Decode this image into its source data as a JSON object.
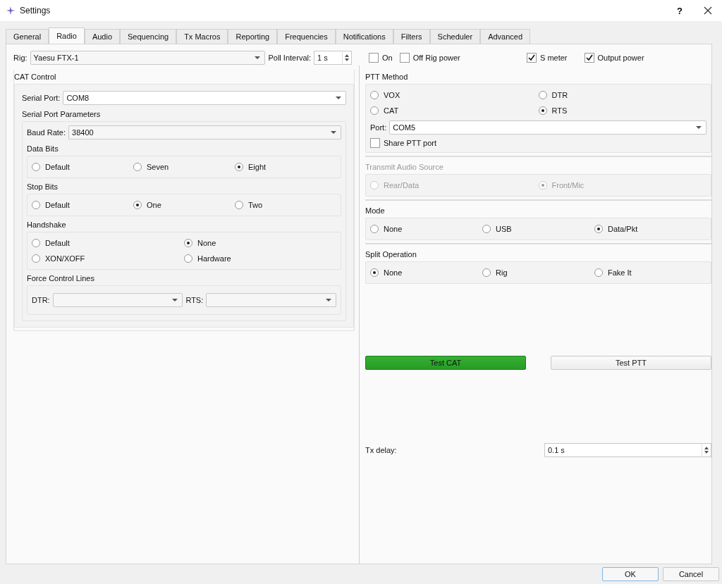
{
  "window": {
    "title": "Settings",
    "help": "?"
  },
  "tabs": [
    {
      "label": "General",
      "selected": false
    },
    {
      "label": "Radio",
      "selected": true
    },
    {
      "label": "Audio",
      "selected": false
    },
    {
      "label": "Sequencing",
      "selected": false
    },
    {
      "label": "Tx Macros",
      "selected": false
    },
    {
      "label": "Reporting",
      "selected": false
    },
    {
      "label": "Frequencies",
      "selected": false
    },
    {
      "label": "Notifications",
      "selected": false
    },
    {
      "label": "Filters",
      "selected": false
    },
    {
      "label": "Scheduler",
      "selected": false
    },
    {
      "label": "Advanced",
      "selected": false
    }
  ],
  "rig": {
    "label": "Rig:",
    "value": "Yaesu FTX-1"
  },
  "poll_interval": {
    "label": "Poll Interval:",
    "value": "1 s"
  },
  "rig_power": [
    {
      "label": "On",
      "checked": false
    },
    {
      "label": "Off Rig power",
      "checked": false
    }
  ],
  "meters": [
    {
      "label": "S meter",
      "checked": true
    },
    {
      "label": "Output power",
      "checked": true
    }
  ],
  "cat_control": {
    "title": "CAT Control",
    "serial_port": {
      "label": "Serial Port:",
      "value": "COM8"
    },
    "params_title": "Serial Port Parameters",
    "baud_rate": {
      "label": "Baud Rate:",
      "value": "38400"
    },
    "groups": [
      {
        "title": "Data Bits",
        "rows": [
          [
            {
              "label": "Default",
              "selected": false
            },
            {
              "label": "Seven",
              "selected": false
            },
            {
              "label": "Eight",
              "selected": true
            }
          ]
        ]
      },
      {
        "title": "Stop Bits",
        "rows": [
          [
            {
              "label": "Default",
              "selected": false
            },
            {
              "label": "One",
              "selected": true
            },
            {
              "label": "Two",
              "selected": false
            }
          ]
        ]
      },
      {
        "title": "Handshake",
        "rows": [
          [
            {
              "label": "Default",
              "selected": false
            },
            {
              "label": "None",
              "selected": true
            }
          ],
          [
            {
              "label": "XON/XOFF",
              "selected": false
            },
            {
              "label": "Hardware",
              "selected": false
            }
          ]
        ]
      }
    ],
    "force_lines": {
      "title": "Force Control Lines",
      "dtr_label": "DTR:",
      "rts_label": "RTS:"
    }
  },
  "ptt_method": {
    "title": "PTT Method",
    "rows": [
      [
        {
          "label": "VOX",
          "selected": false
        },
        {
          "label": "DTR",
          "selected": false
        }
      ],
      [
        {
          "label": "CAT",
          "selected": false
        },
        {
          "label": "RTS",
          "selected": true
        }
      ]
    ],
    "port": {
      "label": "Port:",
      "value": "COM5"
    },
    "share": {
      "label": "Share PTT port",
      "checked": false
    }
  },
  "right_groups": [
    {
      "title": "Transmit Audio Source",
      "disabled": true,
      "rows": [
        [
          {
            "label": "Rear/Data",
            "selected": false
          },
          {
            "label": "Front/Mic",
            "selected": true
          }
        ]
      ]
    },
    {
      "title": "Mode",
      "disabled": false,
      "rows": [
        [
          {
            "label": "None",
            "selected": false
          },
          {
            "label": "USB",
            "selected": false
          },
          {
            "label": "Data/Pkt",
            "selected": true
          }
        ]
      ]
    },
    {
      "title": "Split Operation",
      "disabled": false,
      "rows": [
        [
          {
            "label": "None",
            "selected": true
          },
          {
            "label": "Rig",
            "selected": false
          },
          {
            "label": "Fake It",
            "selected": false
          }
        ]
      ]
    }
  ],
  "test_buttons": [
    {
      "label": "Test CAT",
      "highlighted": true
    },
    {
      "label": "Test PTT",
      "highlighted": false
    }
  ],
  "tx_delay": {
    "label": "Tx delay:",
    "value": "0.1 s"
  },
  "buttons": [
    {
      "label": "OK",
      "default": true
    },
    {
      "label": "Cancel",
      "default": false
    }
  ]
}
